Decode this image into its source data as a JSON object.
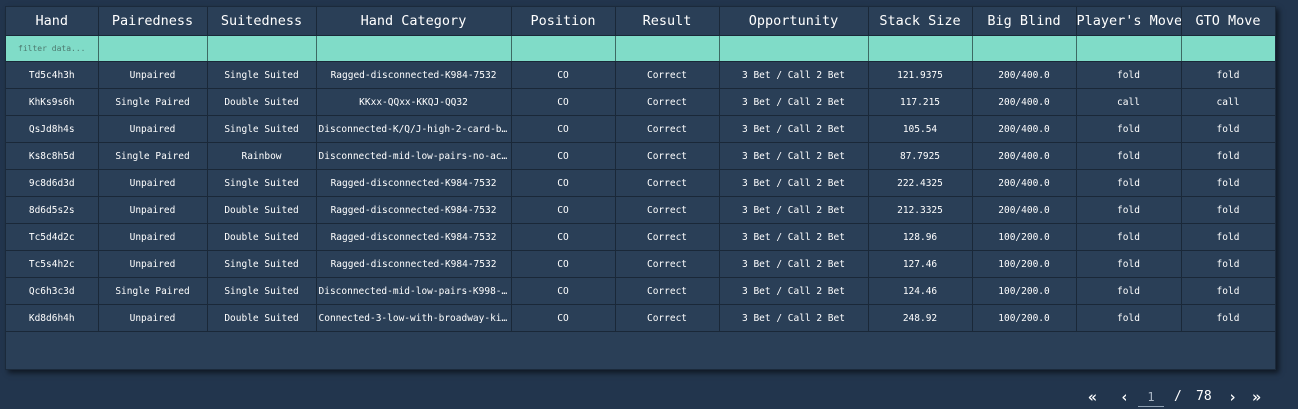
{
  "table": {
    "columns": [
      "Hand",
      "Pairedness",
      "Suitedness",
      "Hand Category",
      "Position",
      "Result",
      "Opportunity",
      "Stack Size",
      "Big Blind",
      "Player's Move",
      "GTO Move"
    ],
    "filter_placeholder": "filter data...",
    "rows": [
      [
        "Td5c4h3h",
        "Unpaired",
        "Single Suited",
        "Ragged-disconnected-K984-7532",
        "CO",
        "Correct",
        "3 Bet / Call 2 Bet",
        "121.9375",
        "200/400.0",
        "fold",
        "fold"
      ],
      [
        "KhKs9s6h",
        "Single Paired",
        "Double Suited",
        "KKxx-QQxx-KKQJ-QQ32",
        "CO",
        "Correct",
        "3 Bet / Call 2 Bet",
        "117.215",
        "200/400.0",
        "call",
        "call"
      ],
      [
        "QsJd8h4s",
        "Unpaired",
        "Single Suited",
        "Disconnected-K/Q/J-high-2-card-bro…",
        "CO",
        "Correct",
        "3 Bet / Call 2 Bet",
        "105.54",
        "200/400.0",
        "fold",
        "fold"
      ],
      [
        "Ks8c8h5d",
        "Single Paired",
        "Rainbow",
        "Disconnected-mid-low-pairs-no-ace-…",
        "CO",
        "Correct",
        "3 Bet / Call 2 Bet",
        "87.7925",
        "200/400.0",
        "fold",
        "fold"
      ],
      [
        "9c8d6d3d",
        "Unpaired",
        "Single Suited",
        "Ragged-disconnected-K984-7532",
        "CO",
        "Correct",
        "3 Bet / Call 2 Bet",
        "222.4325",
        "200/400.0",
        "fold",
        "fold"
      ],
      [
        "8d6d5s2s",
        "Unpaired",
        "Double Suited",
        "Ragged-disconnected-K984-7532",
        "CO",
        "Correct",
        "3 Bet / Call 2 Bet",
        "212.3325",
        "200/400.0",
        "fold",
        "fold"
      ],
      [
        "Tc5d4d2c",
        "Unpaired",
        "Double Suited",
        "Ragged-disconnected-K984-7532",
        "CO",
        "Correct",
        "3 Bet / Call 2 Bet",
        "128.96",
        "100/200.0",
        "fold",
        "fold"
      ],
      [
        "Tc5s4h2c",
        "Unpaired",
        "Single Suited",
        "Ragged-disconnected-K984-7532",
        "CO",
        "Correct",
        "3 Bet / Call 2 Bet",
        "127.46",
        "100/200.0",
        "fold",
        "fold"
      ],
      [
        "Qc6h3c3d",
        "Single Paired",
        "Single Suited",
        "Disconnected-mid-low-pairs-K998-63…",
        "CO",
        "Correct",
        "3 Bet / Call 2 Bet",
        "124.46",
        "100/200.0",
        "fold",
        "fold"
      ],
      [
        "Kd8d6h4h",
        "Unpaired",
        "Double Suited",
        "Connected-3-low-with-broadway-kick…",
        "CO",
        "Correct",
        "3 Bet / Call 2 Bet",
        "248.92",
        "100/200.0",
        "fold",
        "fold"
      ]
    ]
  },
  "pagination": {
    "first_icon": "double-chevron-left-icon",
    "prev_icon": "chevron-left-icon",
    "next_icon": "chevron-right-icon",
    "last_icon": "double-chevron-right-icon",
    "current_page": "1",
    "separator": "/",
    "total_pages": "78"
  },
  "colors": {
    "background": "#22354d",
    "panel": "#2a3f57",
    "filter_row": "#80dcc8",
    "text": "#ffffff"
  }
}
